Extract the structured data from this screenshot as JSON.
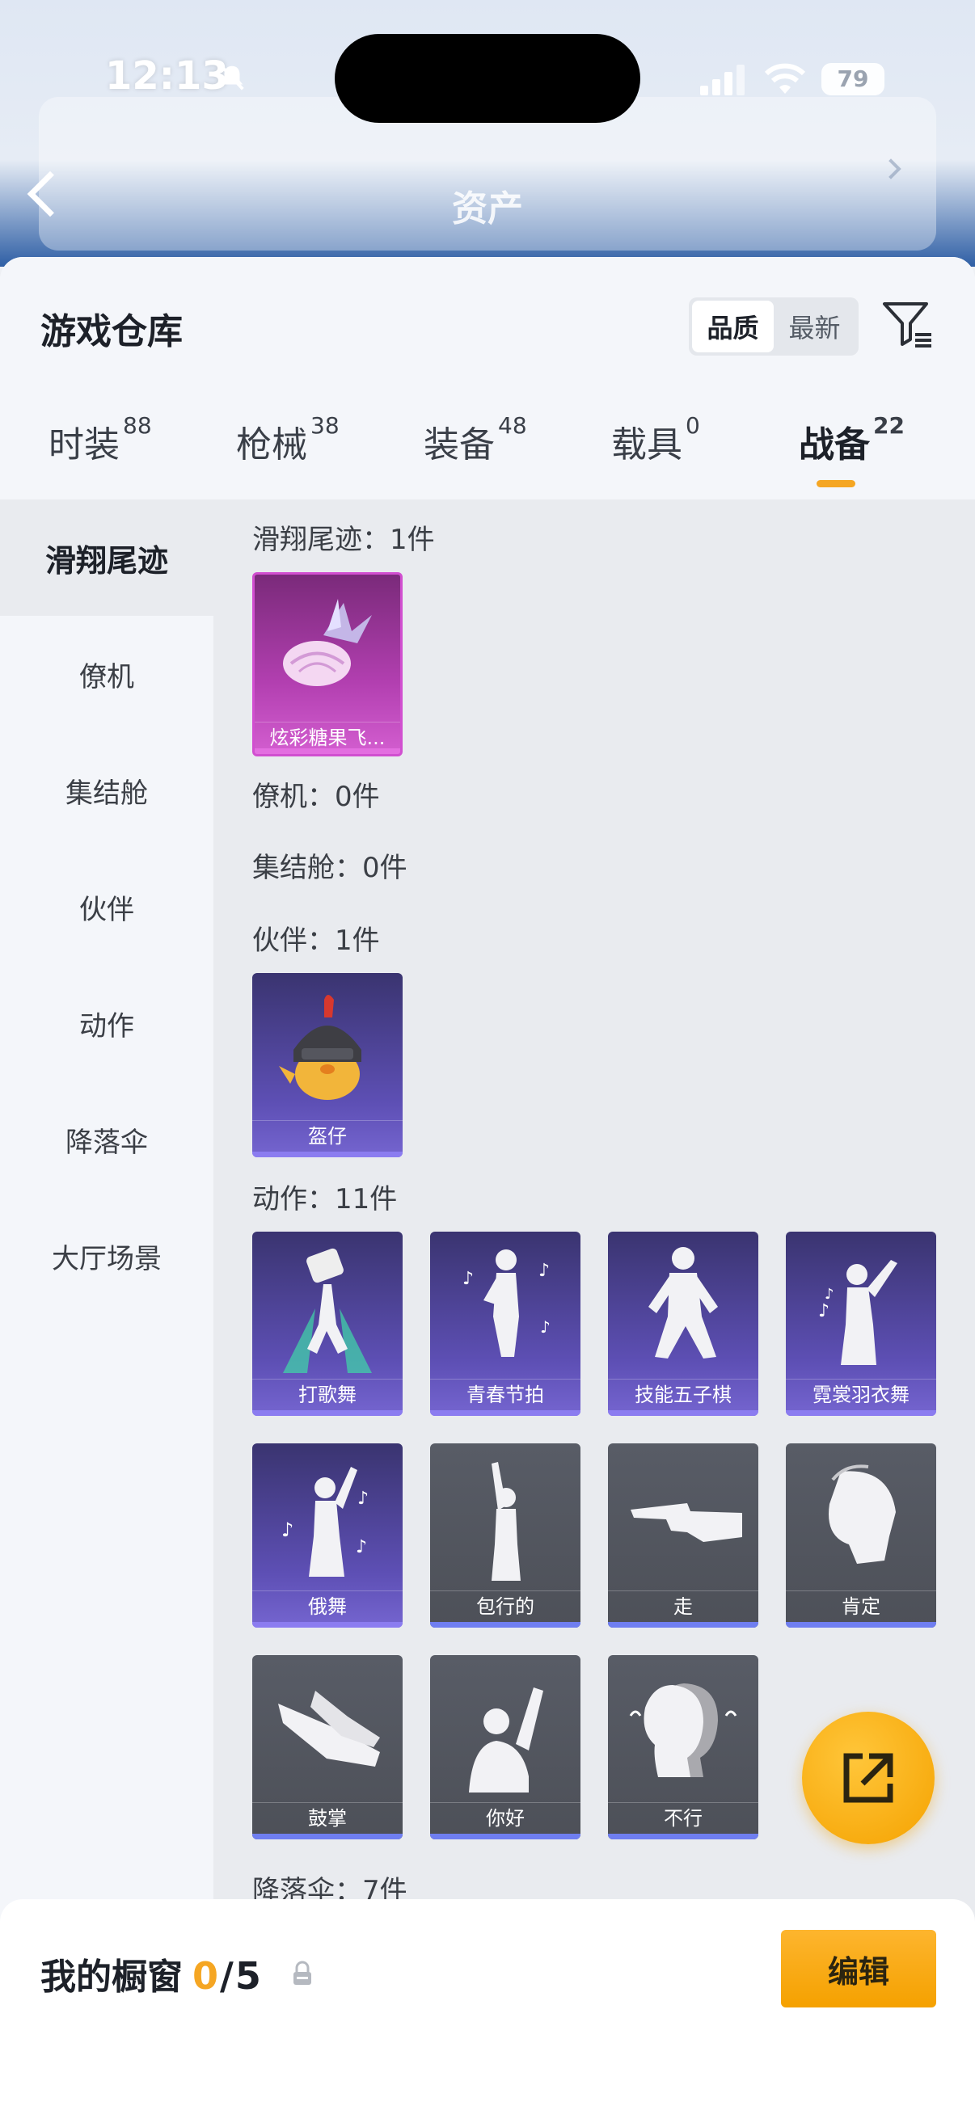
{
  "status_bar": {
    "time": "12:13",
    "battery": "79"
  },
  "header": {
    "title": "资产"
  },
  "sheet": {
    "title": "游戏仓库",
    "sort": {
      "quality": "品质",
      "latest": "最新"
    }
  },
  "tabs": [
    {
      "label": "时装",
      "count": "88"
    },
    {
      "label": "枪械",
      "count": "38"
    },
    {
      "label": "装备",
      "count": "48"
    },
    {
      "label": "载具",
      "count": "0"
    },
    {
      "label": "战备",
      "count": "22"
    }
  ],
  "side_nav": [
    "滑翔尾迹",
    "僚机",
    "集结舱",
    "伙伴",
    "动作",
    "降落伞",
    "大厅场景"
  ],
  "sections": {
    "trail": "滑翔尾迹：1件",
    "wingman": "僚机：0件",
    "pod": "集结舱：0件",
    "partner": "伙伴：1件",
    "emote": "动作：11件",
    "parachute": "降落伞：7件"
  },
  "items": {
    "trail": [
      "炫彩糖果飞..."
    ],
    "partner": [
      "盔仔"
    ],
    "emote": [
      "打歌舞",
      "青春节拍",
      "技能五子棋",
      "霓裳羽衣舞",
      "俄舞",
      "包行的",
      "走",
      "肯定",
      "鼓掌",
      "你好",
      "不行"
    ]
  },
  "showcase": {
    "title": "我的橱窗",
    "count": "0",
    "separator": "/",
    "max": "5",
    "edit": "编辑"
  },
  "colors": {
    "accent": "#f5a623",
    "purple_card": "#5d4fb4",
    "grey_card": "#4d5058",
    "pink_card": "#b23fb0"
  }
}
